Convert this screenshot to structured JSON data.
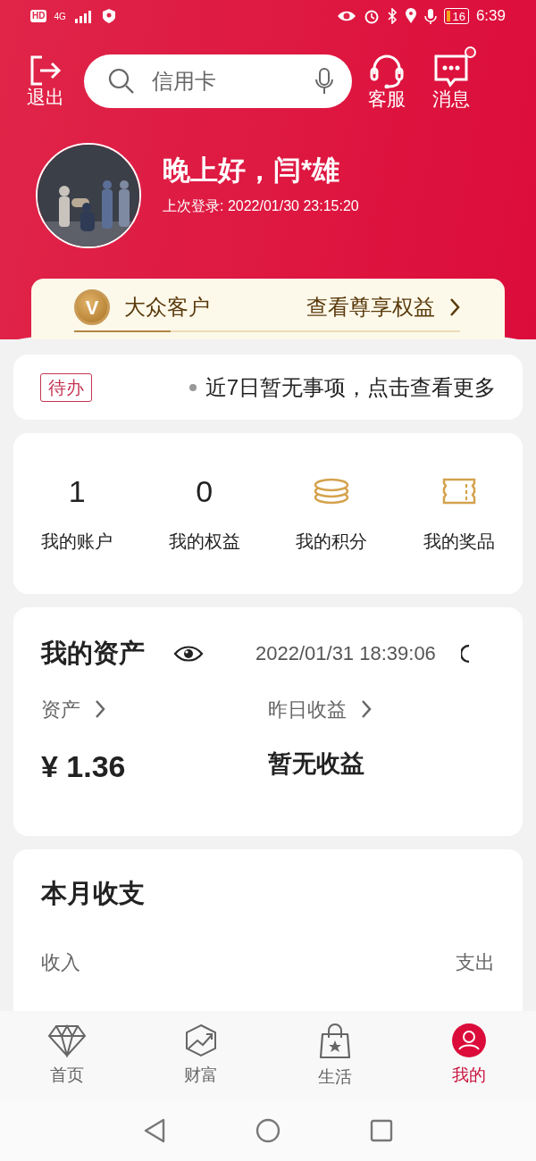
{
  "status_bar": {
    "badges": [
      "HD",
      "4G"
    ],
    "battery": "16",
    "time": "6:39"
  },
  "header": {
    "exit_label": "退出",
    "search": {
      "placeholder": "信用卡"
    },
    "actions": [
      {
        "kind": "service",
        "label": "客服",
        "unread": false
      },
      {
        "kind": "message",
        "label": "消息",
        "unread": true
      }
    ]
  },
  "profile": {
    "greeting": "晚上好，闫*雄",
    "last_login": "上次登录: 2022/01/30 23:15:20"
  },
  "membership": {
    "badge": "V",
    "level_name": "大众客户",
    "link": "查看尊享权益",
    "level": 0.25
  },
  "todo": {
    "tag": "待办",
    "message": "近7日暂无事项，点击查看更多"
  },
  "stats": [
    {
      "kind": "number",
      "value": "1",
      "label": "我的账户"
    },
    {
      "kind": "number",
      "value": "0",
      "label": "我的权益"
    },
    {
      "kind": "coins",
      "label": "我的积分"
    },
    {
      "kind": "ticket",
      "label": "我的奖品"
    }
  ],
  "assets": {
    "title": "我的资产",
    "updated": "2022/01/31 18:39:06",
    "items": [
      {
        "kind": "amount",
        "label": "资产",
        "value": "¥ 1.36"
      },
      {
        "kind": "note",
        "label": "昨日收益",
        "value": "暂无收益"
      }
    ]
  },
  "monthly": {
    "title": "本月收支",
    "income": "收入",
    "expense": "支出"
  },
  "tabs": [
    {
      "kind": "diamond",
      "label": "首页",
      "selected": false
    },
    {
      "kind": "chart",
      "label": "财富",
      "selected": false
    },
    {
      "kind": "bag",
      "label": "生活",
      "selected": false
    },
    {
      "kind": "user",
      "label": "我的",
      "selected": true
    }
  ]
}
